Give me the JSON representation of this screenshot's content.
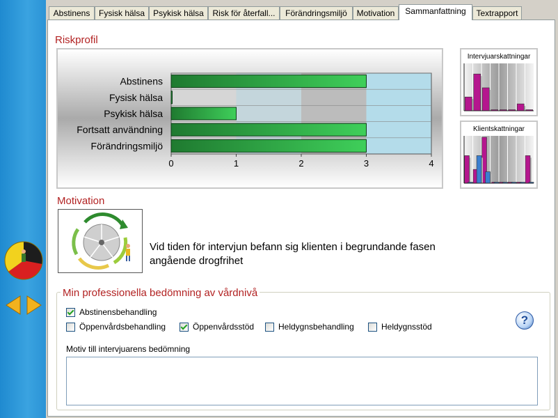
{
  "tabs": [
    {
      "label": "Abstinens",
      "active": false
    },
    {
      "label": "Fysisk hälsa",
      "active": false
    },
    {
      "label": "Psykisk hälsa",
      "active": false
    },
    {
      "label": "Risk för återfall...",
      "active": false
    },
    {
      "label": "Förändringsmiljö",
      "active": false
    },
    {
      "label": "Motivation",
      "active": false
    },
    {
      "label": "Sammanfattning",
      "active": true
    },
    {
      "label": "Textrapport",
      "active": false
    }
  ],
  "riskprofil": {
    "title": "Riskprofil"
  },
  "chart_data": {
    "type": "bar",
    "orientation": "horizontal",
    "categories": [
      "Abstinens",
      "Fysisk hälsa",
      "Psykisk hälsa",
      "Fortsatt användning",
      "Förändringsmiljö"
    ],
    "values": [
      3,
      0,
      1,
      3,
      3
    ],
    "xlim": [
      0,
      4
    ],
    "xticks": [
      "0",
      "1",
      "2",
      "3",
      "4"
    ],
    "grid": false
  },
  "mini_charts": {
    "intervjuar": {
      "title": "Intervjuarskattningar",
      "values": [
        0.3,
        0.8,
        0.5,
        0,
        0,
        0,
        0.15,
        0
      ]
    },
    "klient": {
      "title": "Klientskattningar",
      "values_magenta": [
        0.6,
        0.3,
        1.0,
        0,
        0,
        0,
        0,
        0.6
      ],
      "values_blue": [
        0,
        0.6,
        0.25,
        0,
        0,
        0,
        0,
        0
      ]
    }
  },
  "motivation": {
    "title": "Motivation",
    "text": "Vid tiden för intervjun befann sig klienten i begrundande fasen angående drogfrihet"
  },
  "assessment": {
    "title": "Min professionella bedömning av vårdnivå",
    "options": [
      {
        "label": "Abstinensbehandling",
        "checked": true
      },
      {
        "label": "Öppenvårdsbehandling",
        "checked": false
      },
      {
        "label": "Öppenvårdsstöd",
        "checked": true
      },
      {
        "label": "Heldygnsbehandling",
        "checked": false
      },
      {
        "label": "Heldygnsstöd",
        "checked": false
      }
    ],
    "motiv_label": "Motiv till intervjuarens bedömning",
    "motiv_value": "",
    "help_symbol": "?"
  },
  "colors": {
    "bar_green": "#2d9e3c",
    "accent_red": "#b22222",
    "magenta": "#b5168e",
    "blue": "#3a7fd0"
  },
  "icons": [
    "help-icon",
    "motivation-cycle-icon",
    "progress-pie-icon",
    "previous-arrow-icon",
    "next-arrow-icon"
  ]
}
